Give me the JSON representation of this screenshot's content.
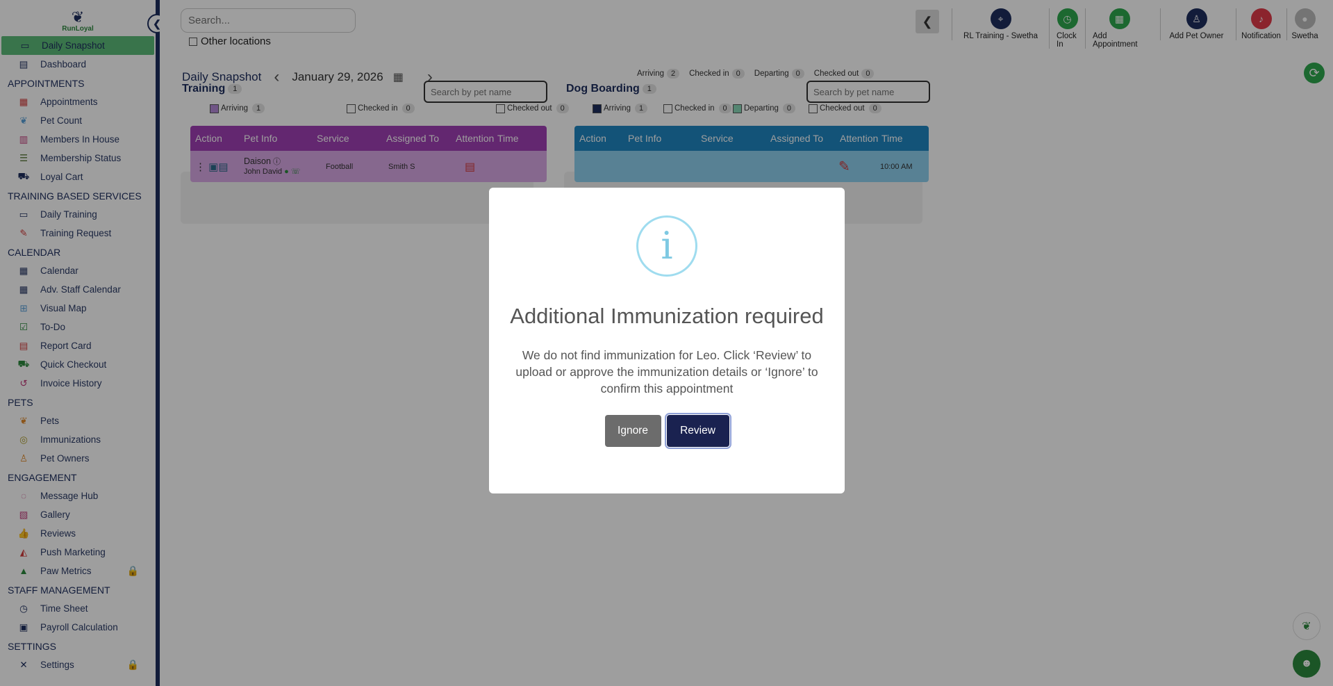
{
  "app": {
    "brand": "RunLoyal"
  },
  "sidebar": {
    "items": [
      {
        "type": "item",
        "label": "Daily Snapshot",
        "icon": "today-icon",
        "active": true,
        "color": "#1d2e5e"
      },
      {
        "type": "item",
        "label": "Dashboard",
        "icon": "dashboard-icon",
        "color": "#1d2e5e"
      },
      {
        "type": "section",
        "label": "APPOINTMENTS"
      },
      {
        "type": "item",
        "label": "Appointments",
        "icon": "calendar-grid-icon",
        "color": "#d23b3b"
      },
      {
        "type": "item",
        "label": "Pet Count",
        "icon": "paw-icon",
        "color": "#5aa0d8"
      },
      {
        "type": "item",
        "label": "Members In House",
        "icon": "house-members-icon",
        "color": "#c0397a"
      },
      {
        "type": "item",
        "label": "Membership Status",
        "icon": "membership-list-icon",
        "color": "#5a7a3a"
      },
      {
        "type": "item",
        "label": "Loyal Cart",
        "icon": "cart-icon",
        "color": "#1d2e5e"
      },
      {
        "type": "section",
        "label": "TRAINING BASED SERVICES"
      },
      {
        "type": "item",
        "label": "Daily Training",
        "icon": "training-today-icon",
        "color": "#1d2e5e"
      },
      {
        "type": "item",
        "label": "Training Request",
        "icon": "training-request-icon",
        "color": "#d23b3b"
      },
      {
        "type": "section",
        "label": "CALENDAR"
      },
      {
        "type": "item",
        "label": "Calendar",
        "icon": "calendar-icon",
        "color": "#1d2e5e"
      },
      {
        "type": "item",
        "label": "Adv. Staff Calendar",
        "icon": "staff-calendar-icon",
        "color": "#1d2e5e"
      },
      {
        "type": "item",
        "label": "Visual Map",
        "icon": "map-grid-icon",
        "color": "#5aa0d8"
      },
      {
        "type": "item",
        "label": "To-Do",
        "icon": "todo-icon",
        "color": "#2d8a3e"
      },
      {
        "type": "item",
        "label": "Report Card",
        "icon": "report-card-icon",
        "color": "#d23b3b"
      },
      {
        "type": "item",
        "label": "Quick Checkout",
        "icon": "checkout-cart-icon",
        "color": "#2d8a3e"
      },
      {
        "type": "item",
        "label": "Invoice History",
        "icon": "history-icon",
        "color": "#c0397a"
      },
      {
        "type": "section",
        "label": "PETS"
      },
      {
        "type": "item",
        "label": "Pets",
        "icon": "paw-icon",
        "color": "#e08a2a"
      },
      {
        "type": "item",
        "label": "Immunizations",
        "icon": "immunization-icon",
        "color": "#b0a030"
      },
      {
        "type": "item",
        "label": "Pet Owners",
        "icon": "person-icon",
        "color": "#e08a2a"
      },
      {
        "type": "section",
        "label": "ENGAGEMENT"
      },
      {
        "type": "item",
        "label": "Message Hub",
        "icon": "message-icon",
        "color": "#c0397a"
      },
      {
        "type": "item",
        "label": "Gallery",
        "icon": "gallery-icon",
        "color": "#c0397a"
      },
      {
        "type": "item",
        "label": "Reviews",
        "icon": "thumbs-up-icon",
        "color": "#8a5ac0"
      },
      {
        "type": "item",
        "label": "Push Marketing",
        "icon": "megaphone-icon",
        "color": "#d23b3b"
      },
      {
        "type": "item",
        "label": "Paw Metrics",
        "icon": "metrics-icon",
        "color": "#2d8a3e",
        "locked": true
      },
      {
        "type": "section",
        "label": "STAFF MANAGEMENT"
      },
      {
        "type": "item",
        "label": "Time Sheet",
        "icon": "clock-icon",
        "color": "#1d2e5e"
      },
      {
        "type": "item",
        "label": "Payroll Calculation",
        "icon": "payroll-icon",
        "color": "#1d2e5e"
      },
      {
        "type": "section",
        "label": "SETTINGS"
      },
      {
        "type": "item",
        "label": "Settings",
        "icon": "settings-icon",
        "color": "#1d2e5e",
        "locked": true
      }
    ]
  },
  "topbar": {
    "search_placeholder": "Search...",
    "other_locations": "Other locations",
    "actions": [
      {
        "label": "RL Training - Swetha",
        "icon": "location-pin-icon",
        "color": "#1d2e5e"
      },
      {
        "label": "Clock In",
        "icon": "clock-icon",
        "color": "#2ea84e"
      },
      {
        "label": "Add Appointment",
        "icon": "add-appointment-icon",
        "color": "#2ea84e"
      },
      {
        "label": "Add Pet Owner",
        "icon": "add-person-icon",
        "color": "#1d2e5e"
      },
      {
        "label": "Notification",
        "icon": "bell-icon",
        "color": "#e03a4a"
      },
      {
        "label": "Swetha",
        "icon": "avatar-icon",
        "color": "#bbbbbb"
      }
    ]
  },
  "snapshot": {
    "title": "Daily Snapshot",
    "date": "January 29, 2026",
    "counts": [
      {
        "label": "Arriving",
        "value": "2"
      },
      {
        "label": "Checked in",
        "value": "0"
      },
      {
        "label": "Departing",
        "value": "0"
      },
      {
        "label": "Checked out",
        "value": "0"
      }
    ]
  },
  "training": {
    "title": "Training",
    "count": "1",
    "search_placeholder": "Search by pet name",
    "filters": [
      {
        "label": "Arriving",
        "value": "1",
        "color": "#b58ad8"
      },
      {
        "label": "Checked in",
        "value": "0",
        "color": "#ffffff"
      },
      {
        "label": "Checked out",
        "value": "0",
        "color": "#ffffff"
      }
    ],
    "columns": [
      "Action",
      "Pet Info",
      "Service",
      "Assigned To",
      "Attention",
      "Time"
    ],
    "header_color": "#a13fb5",
    "row_color": "#d9a8e6",
    "rows": [
      {
        "pet": "Daison",
        "owner": "John David",
        "service": "Football",
        "assigned": "Smith S"
      }
    ]
  },
  "boarding": {
    "title": "Dog Boarding",
    "count": "1",
    "search_placeholder": "Search by pet name",
    "filters": [
      {
        "label": "Arriving",
        "value": "1",
        "color": "#1d2e5e"
      },
      {
        "label": "Checked in",
        "value": "0",
        "color": "#ffffff"
      },
      {
        "label": "Departing",
        "value": "0",
        "color": "#8ad8b8"
      },
      {
        "label": "Checked out",
        "value": "0",
        "color": "#ffffff"
      }
    ],
    "columns": [
      "Action",
      "Pet Info",
      "Service",
      "Assigned To",
      "Attention",
      "Time"
    ],
    "header_color": "#1f86c2",
    "row_color": "#8fd0ef",
    "rows": [
      {
        "time": "10:00 AM"
      }
    ]
  },
  "modal": {
    "title": "Additional Immunization required",
    "message": "We do not find immunization for Leo. Click ‘Review’ to upload or approve the immunization details or ‘Ignore’ to confirm this appointment",
    "ignore_label": "Ignore",
    "review_label": "Review",
    "info_glyph": "i"
  }
}
